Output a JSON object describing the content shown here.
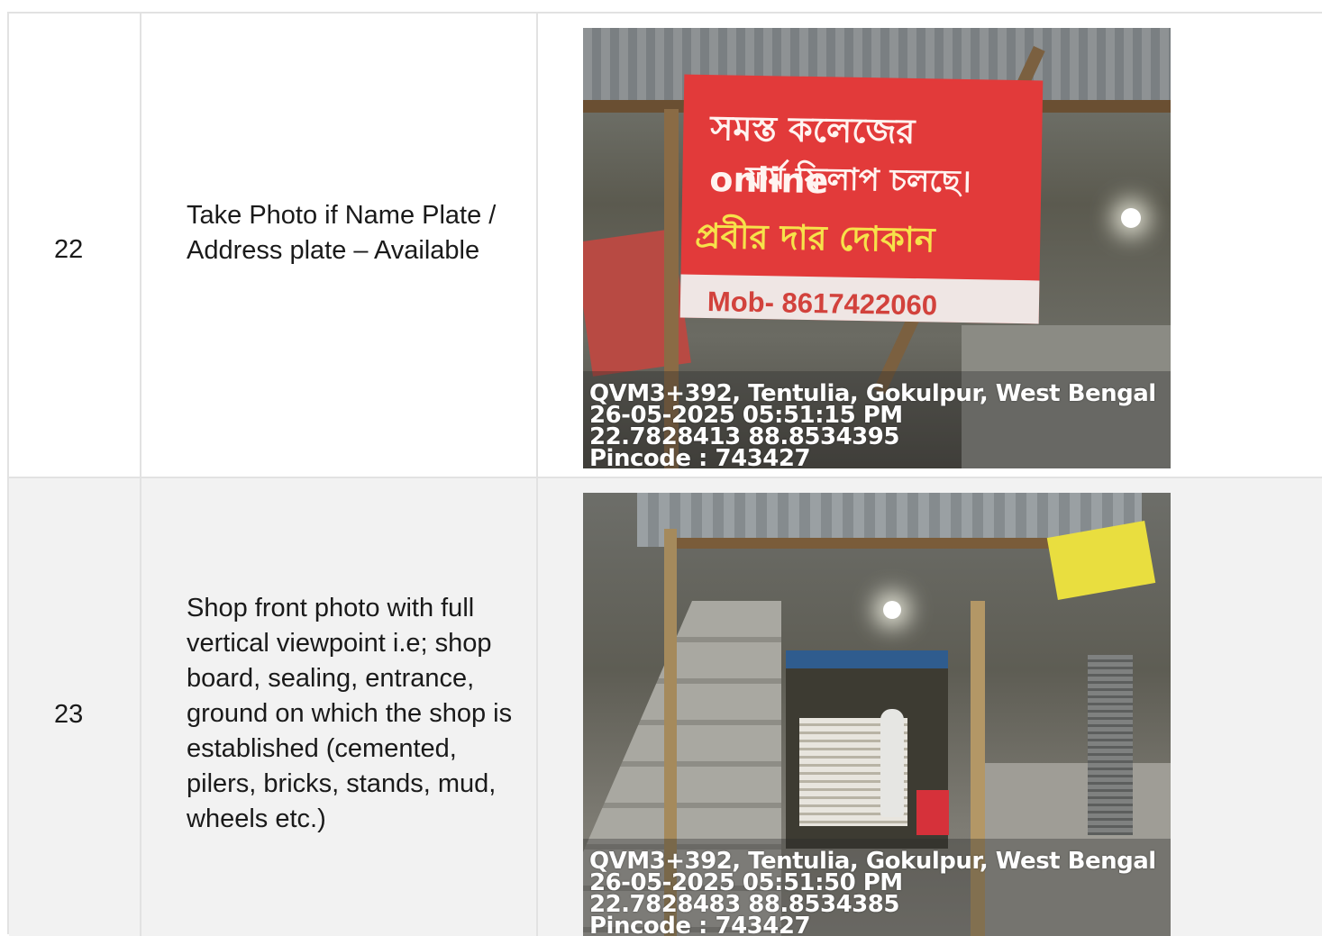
{
  "rows": [
    {
      "number": "22",
      "description": "Take Photo if Name Plate / Address plate – Available",
      "photo": {
        "banner": {
          "line1": "সমস্ত কলেজের online",
          "line2": "ফর্ম ফিলাপ চলছে।",
          "line3": "প্রবীর দার দোকান",
          "line4": "Mob- 8617422060"
        },
        "stamp": {
          "address": "QVM3+392, Tentulia, Gokulpur, West Bengal",
          "datetime": "26-05-2025 05:51:15 PM",
          "coords": "22.7828413 88.8534395",
          "pincode": "Pincode : 743427"
        }
      }
    },
    {
      "number": "23",
      "description": "Shop front photo with full vertical viewpoint i.e; shop board, sealing, entrance, ground on which the shop is established (cemented, pilers, bricks, stands, mud, wheels etc.)",
      "photo": {
        "stamp": {
          "address": "QVM3+392, Tentulia, Gokulpur, West Bengal",
          "datetime": "26-05-2025 05:51:50 PM",
          "coords": "22.7828483 88.8534385",
          "pincode": "Pincode : 743427"
        }
      }
    }
  ]
}
